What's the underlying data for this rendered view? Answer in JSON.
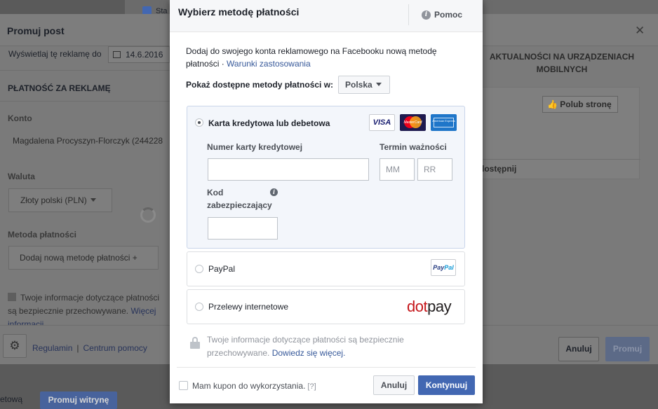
{
  "background": {
    "top_checkbox_label": "Sta",
    "bottom_left_text": "etową",
    "bottom_button": "Promuj witrynę"
  },
  "promote_dialog": {
    "title": "Promuj post",
    "show_until_label": "Wyświetlaj tę reklamę do",
    "date_value": "14.6.2016",
    "payment_section": "PŁATNOŚĆ ZA REKLAMĘ",
    "account_label": "Konto",
    "account_value": "Magdalena Procyszyn-Florczyk (244228",
    "currency_label": "Waluta",
    "currency_value": "Złoty polski (PLN)",
    "method_label": "Metoda płatności",
    "add_method_button": "Dodaj nową metodę płatności +",
    "secure_text": "Twoje informacje dotyczące płatności są bezpiecznie przechowywane.",
    "secure_link": "Więcej informacji.",
    "footer_link_terms": "Regulamin",
    "footer_link_help": "Centrum pomocy",
    "cancel_button": "Anuluj",
    "promote_button": "Promuj",
    "preview_heading": "AKTUALNOŚCI NA URZĄDZENIACH MOBILNYCH",
    "like_button": "Polub stronę",
    "preview_text": "dostępnij"
  },
  "modal": {
    "title": "Wybierz metodę płatności",
    "help_label": "Pomoc",
    "intro_text": "Dodaj do swojego konta reklamowego na Facebooku nową metodę płatności · ",
    "intro_link": "Warunki zastosowania",
    "country_label": "Pokaż dostępne metody płatności w:",
    "country_value": "Polska",
    "options": [
      {
        "label": "Karta kredytowa lub debetowa",
        "selected": true,
        "logos": [
          "VISA",
          "MasterCard",
          "American Express"
        ]
      },
      {
        "label": "PayPal",
        "selected": false,
        "logo_part1": "Pay",
        "logo_part2": "Pal"
      },
      {
        "label": "Przelewy internetowe",
        "selected": false,
        "logo_part1": "dot",
        "logo_part2": "pay"
      }
    ],
    "card_form": {
      "card_number_label": "Numer karty kredytowej",
      "card_number_value": "",
      "expiry_label": "Termin ważności",
      "expiry_month_placeholder": "MM",
      "expiry_year_placeholder": "RR",
      "cvv_label": "Kod zabezpieczający",
      "cvv_value": ""
    },
    "secure_text": "Twoje informacje dotyczące płatności są bezpiecznie przechowywane. ",
    "secure_link": "Dowiedz się więcej.",
    "coupon_label": "Mam kupon do wykorzystania.",
    "coupon_help": "[?]",
    "cancel_button": "Anuluj",
    "continue_button": "Kontynuuj"
  },
  "colors": {
    "primary": "#4267b2",
    "link": "#365899",
    "overlay": "#595959",
    "selected_option_bg": "#f3f6fb"
  },
  "icons": [
    "help-icon",
    "calendar-icon",
    "gear-icon",
    "lock-icon",
    "info-icon",
    "close-icon",
    "thumbs-up-icon",
    "chevron-down-icon"
  ]
}
